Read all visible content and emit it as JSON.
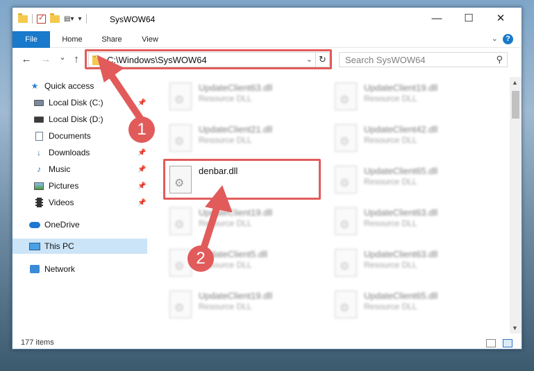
{
  "window": {
    "title": "SysWOW64",
    "controls": {
      "minimize": "—",
      "maximize": "☐",
      "close": "✕"
    }
  },
  "ribbon": {
    "tabs": [
      {
        "label": "File"
      },
      {
        "label": "Home"
      },
      {
        "label": "Share"
      },
      {
        "label": "View"
      }
    ],
    "help": "?"
  },
  "navigation": {
    "back": "←",
    "forward": "→",
    "recent": "⌄",
    "up": "↑",
    "address_path": "C:\\Windows\\SysWOW64",
    "refresh": "↻",
    "search_placeholder": "Search SysWOW64"
  },
  "sidebar": {
    "items": [
      {
        "label": "Quick access",
        "icon": "star-icon"
      },
      {
        "label": "Local Disk (C:)",
        "icon": "disk-icon",
        "pinned": true
      },
      {
        "label": "Local Disk (D:)",
        "icon": "disk-icon"
      },
      {
        "label": "Documents",
        "icon": "documents-icon"
      },
      {
        "label": "Downloads",
        "icon": "downloads-icon",
        "pinned": true
      },
      {
        "label": "Music",
        "icon": "music-icon",
        "pinned": true
      },
      {
        "label": "Pictures",
        "icon": "pictures-icon",
        "pinned": true
      },
      {
        "label": "Videos",
        "icon": "videos-icon",
        "pinned": true
      },
      {
        "label": "OneDrive",
        "icon": "onedrive-icon"
      },
      {
        "label": "This PC",
        "icon": "this-pc-icon",
        "selected": true
      },
      {
        "label": "Network",
        "icon": "network-icon"
      }
    ]
  },
  "files": [
    {
      "name": "UpdateClient63.dll",
      "type": "Resource DLL",
      "blurred": true
    },
    {
      "name": "UpdateClient19.dll",
      "type": "Resource DLL",
      "blurred": true
    },
    {
      "name": "UpdateClient21.dll",
      "type": "Resource DLL",
      "blurred": true
    },
    {
      "name": "UpdateClient42.dll",
      "type": "Resource DLL",
      "blurred": true
    },
    {
      "name": "denbar.dll",
      "type": "",
      "blurred": false
    },
    {
      "name": "UpdateClient65.dll",
      "type": "Resource DLL",
      "blurred": true
    },
    {
      "name": "UpdateClient19.dll",
      "type": "Resource DLL",
      "blurred": true
    },
    {
      "name": "UpdateClient63.dll",
      "type": "Resource DLL",
      "blurred": true
    },
    {
      "name": "UpdateClient5.dll",
      "type": "Resource DLL",
      "blurred": true
    },
    {
      "name": "UpdateClient63.dll",
      "type": "Resource DLL",
      "blurred": true
    },
    {
      "name": "UpdateClient19.dll",
      "type": "Resource DLL",
      "blurred": true
    },
    {
      "name": "UpdateClient65.dll",
      "type": "Resource DLL",
      "blurred": true
    }
  ],
  "status": {
    "item_count": "177 items"
  },
  "annotations": {
    "step1": "1",
    "step2": "2",
    "color": "#e25b5b"
  }
}
